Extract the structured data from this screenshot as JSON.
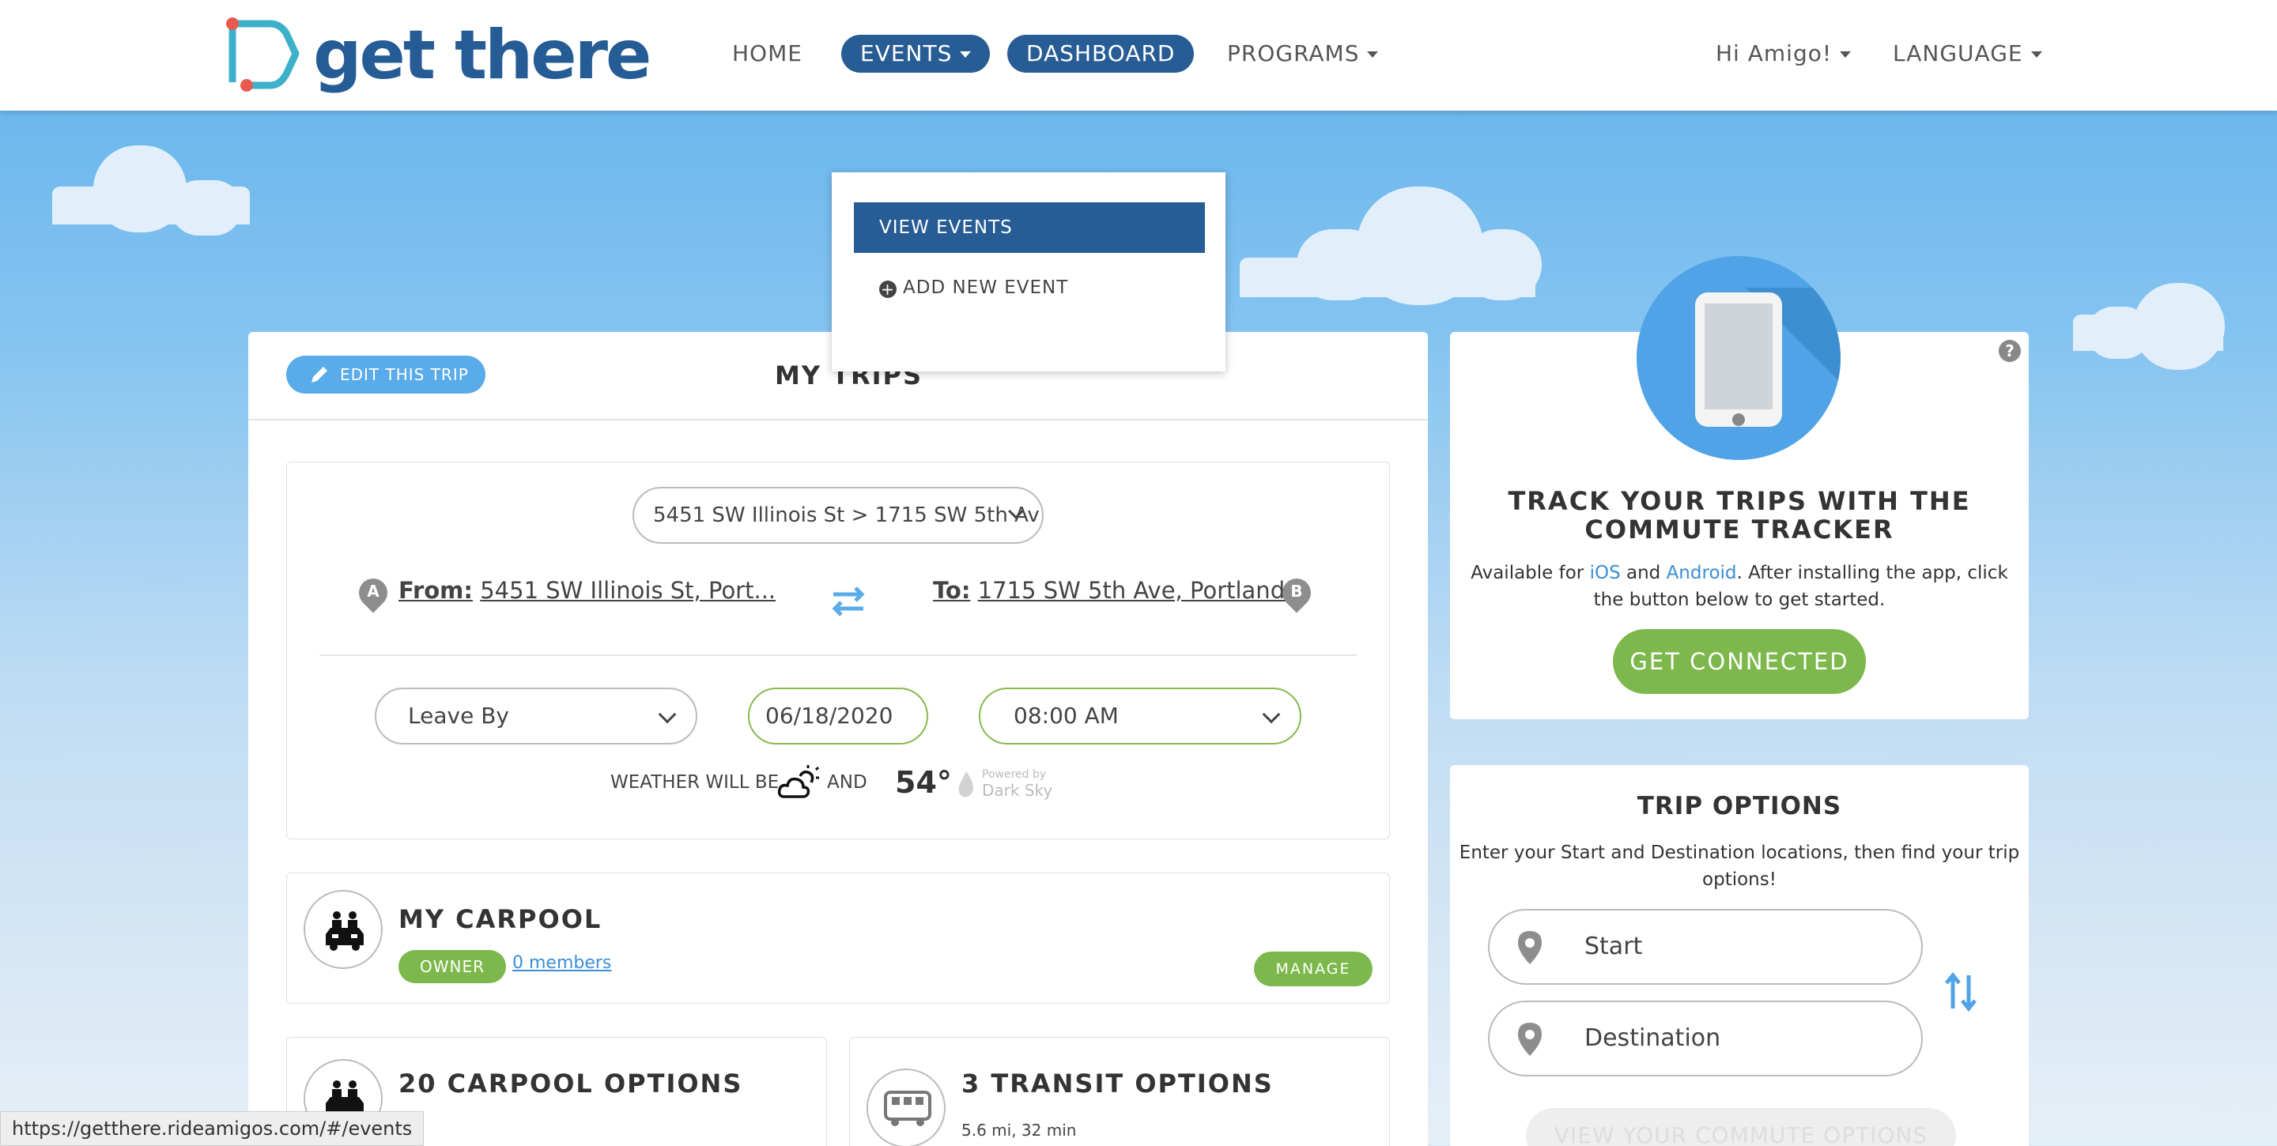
{
  "brand": {
    "logo_text": "get there"
  },
  "nav": {
    "home": "HOME",
    "events": "EVENTS",
    "dashboard": "DASHBOARD",
    "programs": "PROGRAMS",
    "greeting": "Hi Amigo!",
    "language": "LANGUAGE"
  },
  "events_menu": {
    "view": "VIEW EVENTS",
    "add": "ADD NEW EVENT"
  },
  "trips": {
    "edit_button": "EDIT THIS TRIP",
    "title": "MY TRIPS",
    "route_select": "5451 SW Illinois St > 1715 SW 5th Av",
    "from_label": "From:",
    "from_value": "5451 SW Illinois St, Port...",
    "to_label": "To:",
    "to_value": "1715 SW 5th Ave, Portland...",
    "pin_a": "A",
    "pin_b": "B",
    "leave_by": "Leave By",
    "date": "06/18/2020",
    "time": "08:00 AM",
    "weather_prefix": "WEATHER WILL BE",
    "weather_and": "AND",
    "temperature": "54°",
    "powered_by": "Powered by",
    "dark_sky": "Dark Sky"
  },
  "carpool": {
    "title": "MY CARPOOL",
    "role": "OWNER",
    "members": "0 members",
    "manage": "MANAGE"
  },
  "options": {
    "carpool_title": "20 CARPOOL OPTIONS",
    "transit_title": "3 TRANSIT OPTIONS",
    "transit_detail": "5.6 mi, 32 min"
  },
  "tracker": {
    "title_line1": "TRACK YOUR TRIPS WITH THE",
    "title_line2": "COMMUTE TRACKER",
    "text_prefix": "Available for ",
    "ios": "iOS",
    "and": " and ",
    "android": "Android",
    "text_suffix": ". After installing the app, click",
    "text_line2": "the button below to get started.",
    "button": "GET CONNECTED",
    "help": "?"
  },
  "trip_options": {
    "title": "TRIP OPTIONS",
    "desc_line1": "Enter your Start and Destination locations, then find your trip",
    "desc_line2": "options!",
    "start_placeholder": "Start",
    "destination_placeholder": "Destination",
    "view_button": "VIEW YOUR COMMUTE OPTIONS"
  },
  "status_bar": {
    "url": "https://getthere.rideamigos.com/#/events"
  },
  "colors": {
    "brand_blue": "#275d94",
    "light_blue": "#5aabea",
    "green": "#7db84c",
    "sky": "#5fb2ec"
  }
}
